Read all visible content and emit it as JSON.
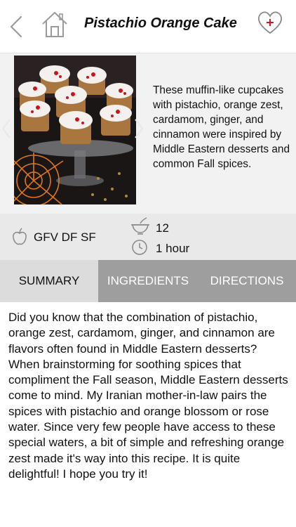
{
  "header": {
    "title": "Pistachio Orange Cake",
    "back_icon": "chevron-left-icon",
    "home_icon": "home-icon",
    "favorite_icon": "heart-plus-icon"
  },
  "recipe": {
    "description": "These muffin-like cupcakes with pistachio, orange zest, cardamom, ginger, and cinnamon were inspired by Middle Eastern desserts and common Fall spices."
  },
  "info": {
    "diet": "GFV DF SF",
    "servings": "12",
    "time": "1 hour"
  },
  "tabs": [
    {
      "label": "SUMMARY",
      "active": true
    },
    {
      "label": "INGREDIENTS",
      "active": false
    },
    {
      "label": "DIRECTIONS",
      "active": false
    }
  ],
  "summary": {
    "text": "Did you know that the combination of pistachio, orange zest, cardamom, ginger, and cinnamon are flavors often found in Middle Eastern desserts? When brainstorming for soothing spices that compliment the Fall season, Middle Eastern desserts come to mind. My Iranian mother-in-law pairs the spices with pistachio and orange blossom or rose water. Since very few people have access to these special waters, a bit of simple and refreshing orange zest made it's way into this recipe. It is quite delightful! I hope you try it!"
  },
  "colors": {
    "accent_red": "#d0142c",
    "tab_bar": "#9e9e9e",
    "tab_active": "#dcdcdc",
    "hero_bg": "#f2f2f2",
    "info_bg": "#e9e9e9"
  }
}
